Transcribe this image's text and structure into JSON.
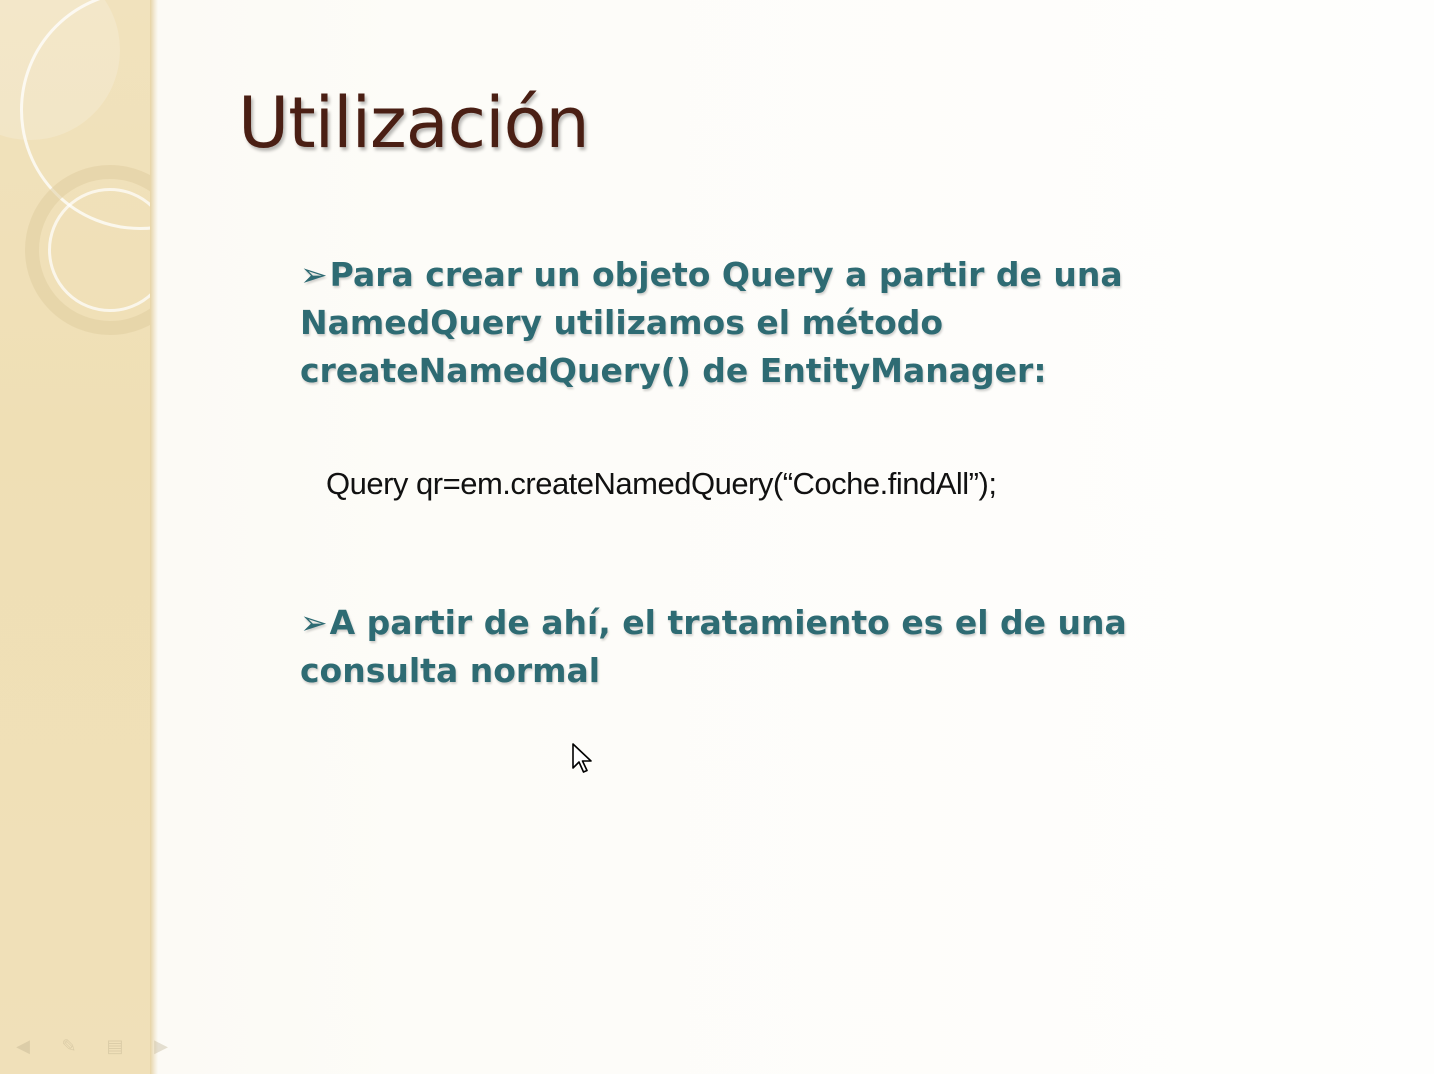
{
  "slide": {
    "title": "Utilización",
    "bullets": [
      {
        "marker": "➢",
        "text": "Para crear un objeto Query a partir de una NamedQuery utilizamos el método createNamedQuery() de EntityManager:"
      },
      {
        "marker": "➢",
        "text": "A partir de ahí, el tratamiento es el de una consulta normal"
      }
    ],
    "code": "Query qr=em.createNamedQuery(“Coche.findAll”);"
  },
  "colors": {
    "title": "#4a1f14",
    "bullet_text": "#2e6b73",
    "sidebar": "#efdfb5",
    "background": "#fdfcf9"
  },
  "icons": {
    "bullet": "arrow-bullet-icon",
    "cursor": "mouse-pointer-icon",
    "nav": [
      "prev-slide-icon",
      "pen-icon",
      "menu-icon",
      "next-slide-icon"
    ]
  }
}
